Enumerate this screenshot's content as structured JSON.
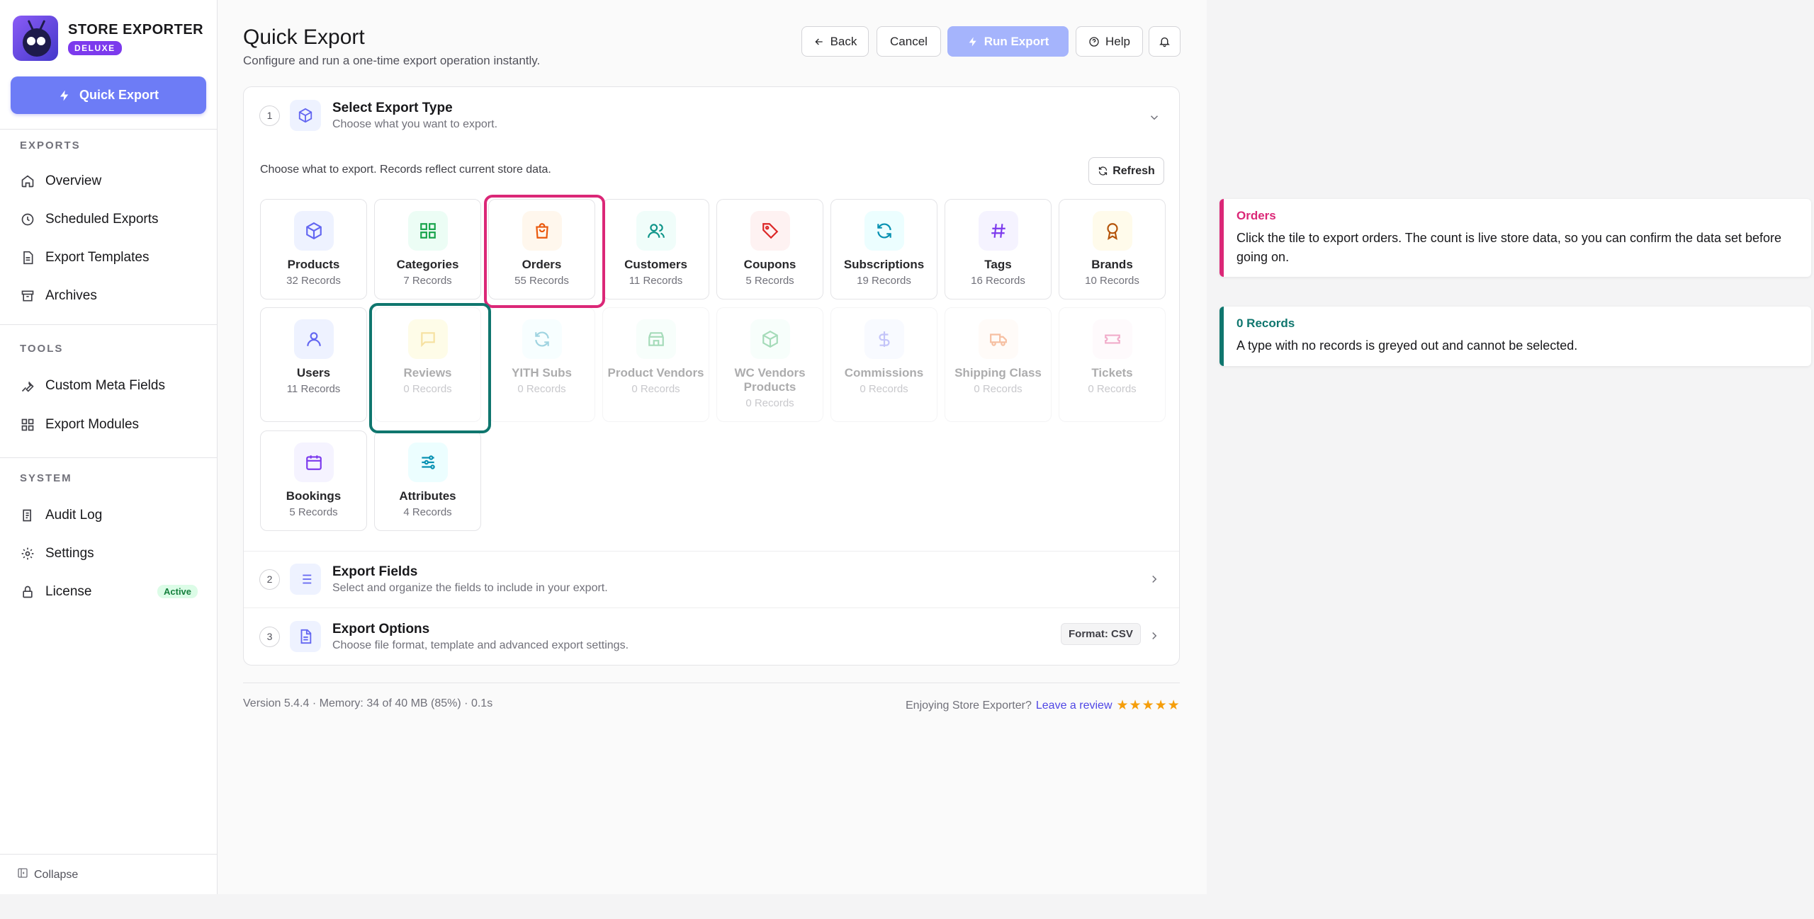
{
  "brand": {
    "title": "STORE EXPORTER",
    "badge": "DELUXE"
  },
  "sidebar": {
    "quick_export": "Quick Export",
    "sections": [
      {
        "label": "EXPORTS",
        "items": [
          "Overview",
          "Scheduled Exports",
          "Export Templates",
          "Archives"
        ]
      },
      {
        "label": "TOOLS",
        "items": [
          "Custom Meta Fields",
          "Export Modules"
        ]
      },
      {
        "label": "SYSTEM",
        "items": [
          "Audit Log",
          "Settings",
          "License"
        ]
      }
    ],
    "license_badge": "Active",
    "collapse": "Collapse"
  },
  "header": {
    "title": "Quick Export",
    "subtitle": "Configure and run a one-time export operation instantly.",
    "back": "Back",
    "cancel": "Cancel",
    "run": "Run Export",
    "help": "Help"
  },
  "steps": [
    {
      "num": "1",
      "title": "Select Export Type",
      "desc": "Choose what you want to export."
    },
    {
      "num": "2",
      "title": "Export Fields",
      "desc": "Select and organize the fields to include in your export."
    },
    {
      "num": "3",
      "title": "Export Options",
      "desc": "Choose file format, template and advanced export settings."
    }
  ],
  "export_types": {
    "hint": "Choose what to export. Records reflect current store data.",
    "refresh": "Refresh",
    "tiles": [
      {
        "name": "Products",
        "count": "32 Records"
      },
      {
        "name": "Categories",
        "count": "7 Records"
      },
      {
        "name": "Orders",
        "count": "55 Records"
      },
      {
        "name": "Customers",
        "count": "11 Records"
      },
      {
        "name": "Coupons",
        "count": "5 Records"
      },
      {
        "name": "Subscriptions",
        "count": "19 Records"
      },
      {
        "name": "Tags",
        "count": "16 Records"
      },
      {
        "name": "Brands",
        "count": "10 Records"
      },
      {
        "name": "Users",
        "count": "11 Records"
      },
      {
        "name": "Reviews",
        "count": "0 Records"
      },
      {
        "name": "YITH Subs",
        "count": "0 Records"
      },
      {
        "name": "Product Vendors",
        "count": "0 Records"
      },
      {
        "name": "WC Vendors Products",
        "count": "0 Records"
      },
      {
        "name": "Commissions",
        "count": "0 Records"
      },
      {
        "name": "Shipping Class",
        "count": "0 Records"
      },
      {
        "name": "Tickets",
        "count": "0 Records"
      },
      {
        "name": "Bookings",
        "count": "5 Records"
      },
      {
        "name": "Attributes",
        "count": "4 Records"
      }
    ]
  },
  "format_badge": "Format: CSV",
  "footer": {
    "version": "Version 5.4.4",
    "memory": "Memory: 34 of 40 MB (85%)",
    "time": "0.1s",
    "enjoy": "Enjoying Store Exporter?",
    "review": "Leave a review",
    "stars": "★★★★★"
  },
  "notes": [
    {
      "title": "Orders",
      "body": "Click the tile to export orders. The count is live store data, so you can confirm the data set before going on.",
      "color": "#db2777"
    },
    {
      "title": "0 Records",
      "body": "A type with no records is greyed out and cannot be selected.",
      "color": "#0f766e"
    }
  ],
  "colors": {
    "accent": "#6d7cf6",
    "highlight_orders": "#db2777",
    "highlight_empty": "#0f766e"
  }
}
